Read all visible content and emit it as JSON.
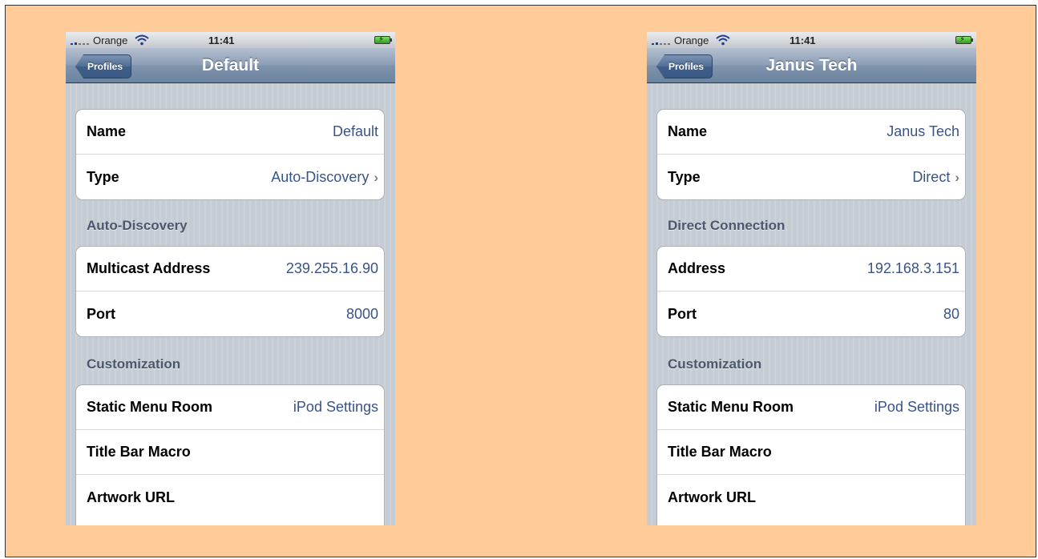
{
  "phones": [
    {
      "status": {
        "carrier": "Orange",
        "time": "11:41"
      },
      "nav": {
        "back_label": "Profiles",
        "title": "Default"
      },
      "general": {
        "name_label": "Name",
        "name_value": "Default",
        "type_label": "Type",
        "type_value": "Auto-Discovery"
      },
      "connection": {
        "header": "Auto-Discovery",
        "address_label": "Multicast Address",
        "address_value": "239.255.16.90",
        "port_label": "Port",
        "port_value": "8000"
      },
      "customization": {
        "header": "Customization",
        "static_menu_label": "Static Menu Room",
        "static_menu_value": "iPod Settings",
        "title_bar_label": "Title Bar Macro",
        "artwork_label": "Artwork URL"
      }
    },
    {
      "status": {
        "carrier": "Orange",
        "time": "11:41"
      },
      "nav": {
        "back_label": "Profiles",
        "title": "Janus Tech"
      },
      "general": {
        "name_label": "Name",
        "name_value": "Janus Tech",
        "type_label": "Type",
        "type_value": "Direct"
      },
      "connection": {
        "header": "Direct Connection",
        "address_label": "Address",
        "address_value": "192.168.3.151",
        "port_label": "Port",
        "port_value": "80"
      },
      "customization": {
        "header": "Customization",
        "static_menu_label": "Static Menu Room",
        "static_menu_value": "iPod Settings",
        "title_bar_label": "Title Bar Macro",
        "artwork_label": "Artwork URL"
      }
    }
  ],
  "colors": {
    "background": "#ffcc99",
    "value_text": "#385487",
    "nav_bar": "#7f93ac"
  }
}
